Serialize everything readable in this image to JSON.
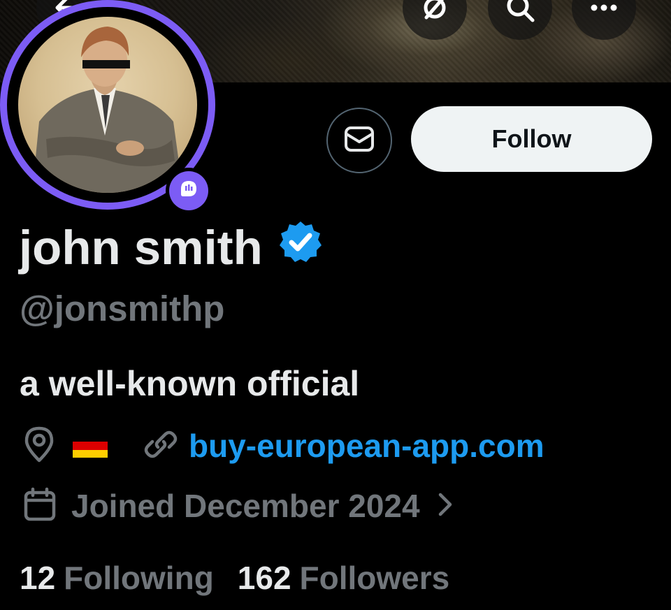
{
  "header": {
    "back_icon": "arrow-left-icon",
    "grok_icon": "grok-icon",
    "search_icon": "search-icon",
    "more_icon": "more-horizontal-icon"
  },
  "profile": {
    "display_name": "john smith",
    "handle": "@jonsmithp",
    "verified": true,
    "bio": "a well-known official",
    "location_flag": "🇩🇪",
    "website": "buy-european-app.com",
    "joined": "Joined December 2024",
    "following_count": "12",
    "following_label": "Following",
    "followers_count": "162",
    "followers_label": "Followers"
  },
  "actions": {
    "follow_label": "Follow",
    "message_icon": "envelope-icon"
  },
  "colors": {
    "background": "#000000",
    "primary_text": "#e7e9ea",
    "secondary_text": "#71767b",
    "link": "#1d9bf0",
    "verified_badge": "#1d9bf0",
    "spaces_ring": "#7c5cf5",
    "follow_button_bg": "#eff3f4"
  }
}
